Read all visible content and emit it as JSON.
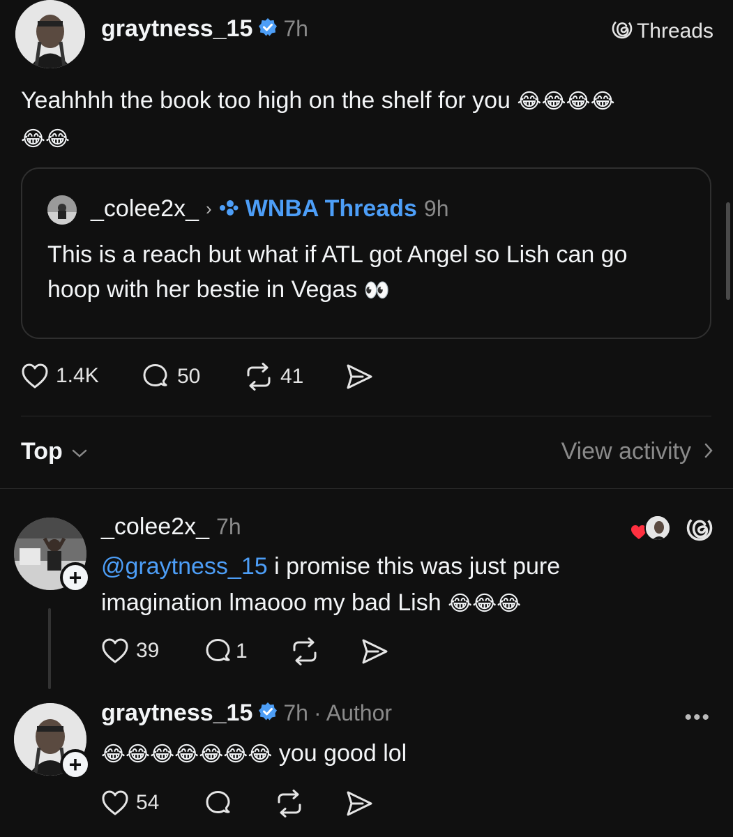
{
  "header": {
    "brand_label": "Threads"
  },
  "main_post": {
    "username": "graytness_15",
    "time": "7h",
    "text_line1": "Yeahhhh the book too high on the shelf for you",
    "emoji_line1": "😂😂😂😂",
    "emoji_line2": "😂😂",
    "quote": {
      "username": "_colee2x_",
      "community": "WNBA Threads",
      "time": "9h",
      "line1": "This is a reach but what if ATL got Angel so Lish can go",
      "line2": "hoop with her bestie in Vegas",
      "emoji": "👀"
    },
    "stats": {
      "likes": "1.4K",
      "replies": "50",
      "reposts": "41"
    }
  },
  "sort_bar": {
    "sort_label": "Top",
    "view_activity_label": "View activity"
  },
  "replies": [
    {
      "username": "_colee2x_",
      "time": "7h",
      "mention": "@graytness_15",
      "text_after_mention": " i promise this was just pure",
      "text_line2": "imagination lmaooo my bad Lish",
      "emoji": "😂😂😂",
      "likes": "39",
      "replies": "1"
    },
    {
      "username": "graytness_15",
      "time": "7h",
      "author_tag": "· Author",
      "emoji": "😂😂😂😂😂😂😂",
      "text": "you good lol",
      "likes": "54"
    }
  ],
  "colors": {
    "background": "#101010",
    "text": "#f3f5f7",
    "muted": "#8a8a8a",
    "link": "#4d9ef7",
    "verified": "#1d9bf0",
    "heart_red": "#ff3040"
  }
}
